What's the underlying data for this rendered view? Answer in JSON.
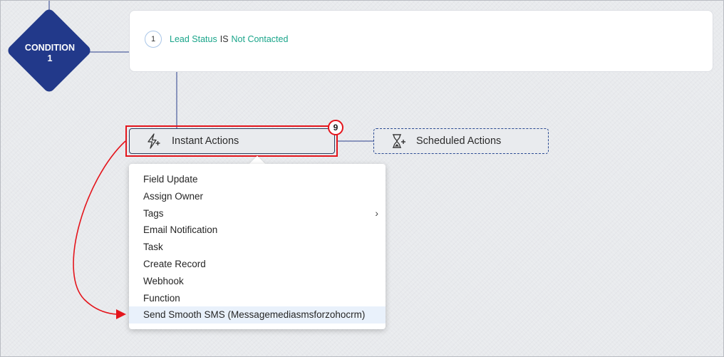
{
  "condition": {
    "label_line1": "CONDITION",
    "label_line2": "1"
  },
  "criteria": [
    {
      "number": "1",
      "field": "Lead Status",
      "operator": "IS",
      "value": "Not Contacted"
    }
  ],
  "instant_actions": {
    "label": "Instant Actions",
    "icon": "lightning-plus-icon"
  },
  "scheduled_actions": {
    "label": "Scheduled Actions",
    "icon": "hourglass-plus-icon"
  },
  "annotation": {
    "step_number": "9",
    "color": "#e4151c"
  },
  "menu": {
    "items": [
      {
        "label": "Field Update"
      },
      {
        "label": "Assign Owner"
      },
      {
        "label": "Tags",
        "has_submenu": true
      },
      {
        "label": "Email Notification"
      },
      {
        "label": "Task"
      },
      {
        "label": "Create Record"
      },
      {
        "label": "Webhook"
      },
      {
        "label": "Function"
      },
      {
        "label": "Send Smooth SMS (Messagemediasmsforzohocrm)",
        "highlighted": true
      }
    ]
  },
  "colors": {
    "condition_node": "#22398a",
    "criteria_green": "#1aa58a",
    "highlight_row": "#e9f1fb"
  }
}
